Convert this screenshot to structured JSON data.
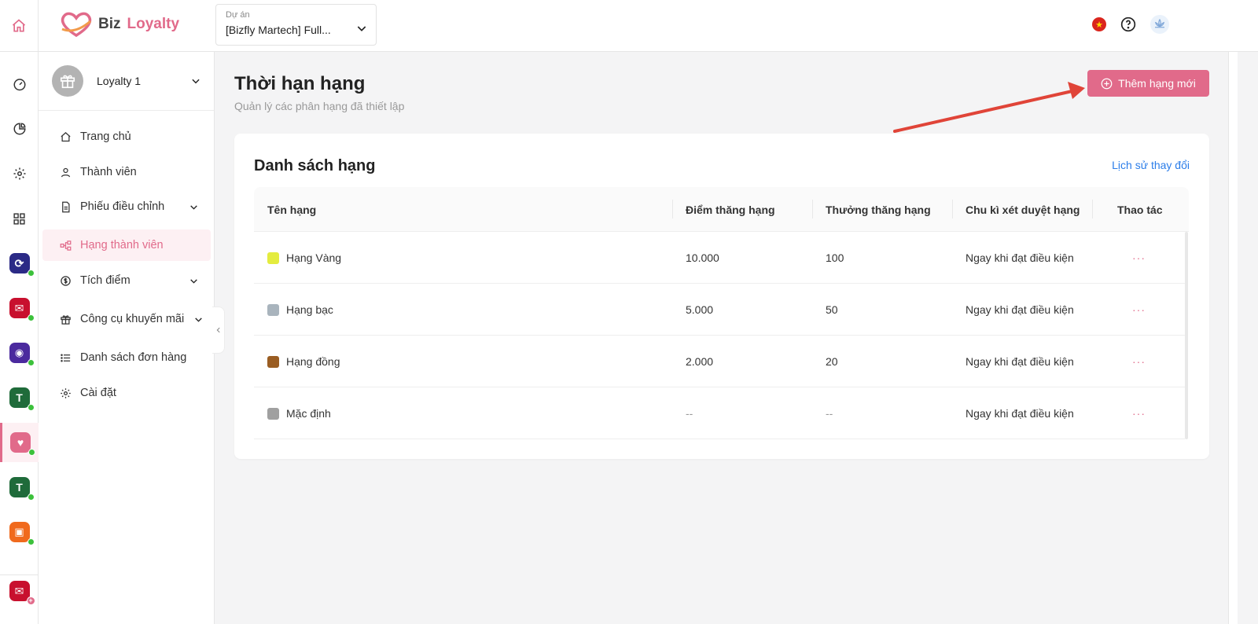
{
  "brand": {
    "name_part1": "Biz",
    "name_part2": "Loyalty",
    "accent": "#e16a8a"
  },
  "project": {
    "label": "Dự án",
    "value": "[Bizfly Martech] Full..."
  },
  "sidebar": {
    "workspace": "Loyalty 1",
    "items": [
      {
        "label": "Trang chủ",
        "icon": "home-icon"
      },
      {
        "label": "Thành viên",
        "icon": "user-icon"
      },
      {
        "label": "Phiếu điều chỉnh",
        "icon": "document-icon"
      },
      {
        "label": "Hạng thành viên",
        "icon": "hierarchy-icon"
      },
      {
        "label": "Tích điểm",
        "icon": "coin-icon"
      },
      {
        "label": "Công cụ khuyến mãi",
        "icon": "gift-icon"
      },
      {
        "label": "Danh sách đơn hàng",
        "icon": "list-icon"
      },
      {
        "label": "Cài đặt",
        "icon": "gear-icon"
      }
    ]
  },
  "page": {
    "title": "Thời hạn hạng",
    "subtitle": "Quản lý các phân hạng đã thiết lập",
    "add_button": "Thêm hạng mới"
  },
  "card": {
    "title": "Danh sách hạng",
    "history_link": "Lịch sử thay đổi",
    "columns": [
      "Tên hạng",
      "Điểm thăng hạng",
      "Thưởng thăng hạng",
      "Chu kì xét duyệt hạng",
      "Thao tác"
    ],
    "rows": [
      {
        "name": "Hạng Vàng",
        "color": "#e4ec3f",
        "points": "10.000",
        "reward": "100",
        "cycle": "Ngay khi đạt điều kiện",
        "action": "···"
      },
      {
        "name": "Hạng bạc",
        "color": "#a9b4bd",
        "points": "5.000",
        "reward": "50",
        "cycle": "Ngay khi đạt điều kiện",
        "action": "···"
      },
      {
        "name": "Hạng đồng",
        "color": "#9a5d22",
        "points": "2.000",
        "reward": "20",
        "cycle": "Ngay khi đạt điều kiện",
        "action": "···"
      },
      {
        "name": "Mặc định",
        "color": "#a0a0a0",
        "points": "--",
        "reward": "--",
        "cycle": "Ngay khi đạt điều kiện",
        "action": "···"
      }
    ]
  }
}
